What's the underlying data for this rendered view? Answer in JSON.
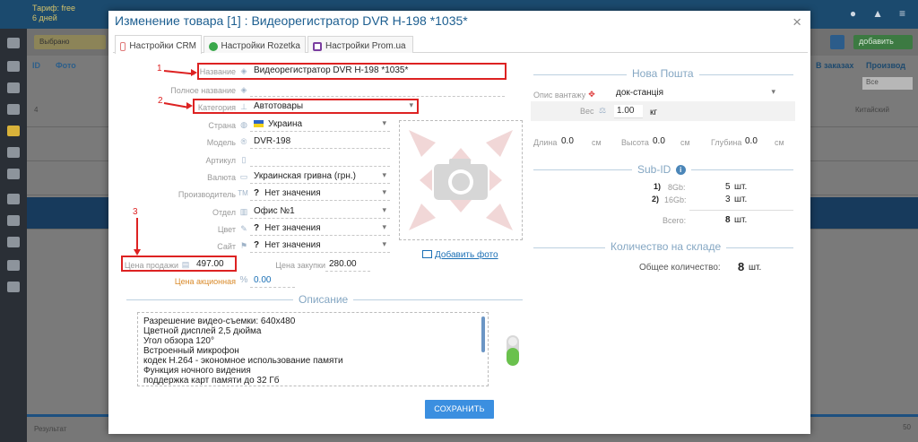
{
  "background": {
    "brand": "Тариф: free\n6 дней",
    "toolbar_left": "Выбрано",
    "add_button": "добавить",
    "columns": {
      "id": "ID",
      "photo": "Фото",
      "in_orders": "В заказах",
      "producer": "Производ"
    },
    "filter_value": "Все",
    "row_values": [
      "Китайский",
      "",
      ""
    ],
    "rows": [
      {
        "id": "4"
      },
      {
        "id": ""
      },
      {
        "id": ""
      }
    ],
    "result_label": "Результат",
    "page_size": "50"
  },
  "modal": {
    "title": "Изменение товара [1] : Видеорегистратор DVR H-198 *1035*",
    "close": "×",
    "tabs": [
      {
        "label": "Настройки CRM",
        "color": "#e07a7a"
      },
      {
        "label": "Настройки Rozetka",
        "color": "#39a84a"
      },
      {
        "label": "Настройки Prom.ua",
        "color": "#7b3ea0"
      }
    ],
    "annotations": [
      "1",
      "2",
      "3"
    ],
    "form": {
      "name": {
        "label": "Название",
        "value": "Видеорегистратор DVR H-198 *1035*"
      },
      "full_name": {
        "label": "Полное название",
        "value": ""
      },
      "category": {
        "label": "Категория",
        "value": "Автотовары"
      },
      "country": {
        "label": "Страна",
        "value": "Украина"
      },
      "model": {
        "label": "Модель",
        "value": "DVR-198"
      },
      "article": {
        "label": "Артикул",
        "value": ""
      },
      "currency": {
        "label": "Валюта",
        "value": "Украинская гривна (грн.)"
      },
      "producer": {
        "label": "Производитель",
        "value": "Нет значения"
      },
      "department": {
        "label": "Отдел",
        "value": "Офис №1"
      },
      "color": {
        "label": "Цвет",
        "value": "Нет значения"
      },
      "site": {
        "label": "Сайт",
        "value": "Нет значения"
      },
      "sale_price": {
        "label": "Цена продажи",
        "value": "497.00"
      },
      "purchase_price": {
        "label": "Цена закупки",
        "value": "280.00"
      },
      "promo_price": {
        "label": "Цена акционная",
        "value": "0.00"
      },
      "add_photo": "Добавить фото",
      "tm_mark": "TM",
      "question_mark": "?"
    },
    "description": {
      "title": "Описание",
      "lines": [
        "Разрешение видео-съемки: 640x480",
        "Цветной дисплей 2,5 дюйма",
        "Угол обзора 120°",
        "Встроенный микрофон",
        "кодек H.264 - экономное использование памяти",
        "Функция ночного видения",
        "поддержка карт памяти до 32 Гб"
      ],
      "toggle_on": true
    },
    "save_label": "СОХРАНИТЬ",
    "nova_poshta": {
      "title": "Нова Пошта",
      "cargo_label": "Опис вантажу",
      "cargo_value": "док-станція",
      "weight_label": "Вес",
      "weight_value": "1.00",
      "weight_unit": "кг",
      "length_label": "Длина",
      "length_value": "0.0",
      "height_label": "Высота",
      "height_value": "0.0",
      "depth_label": "Глубина",
      "depth_value": "0.0",
      "unit_cm": "см"
    },
    "sub_id": {
      "title": "Sub-ID",
      "info_icon": "i",
      "items": [
        {
          "num": "1)",
          "label": "8Gb:",
          "qty": "5",
          "unit": "шт."
        },
        {
          "num": "2)",
          "label": "16Gb:",
          "qty": "3",
          "unit": "шт."
        }
      ],
      "total_label": "Всего:",
      "total_value": "8",
      "total_unit": "шт."
    },
    "stock": {
      "title": "Количество на складе",
      "total_label": "Общее количество:",
      "total_value": "8",
      "unit": "шт."
    }
  }
}
